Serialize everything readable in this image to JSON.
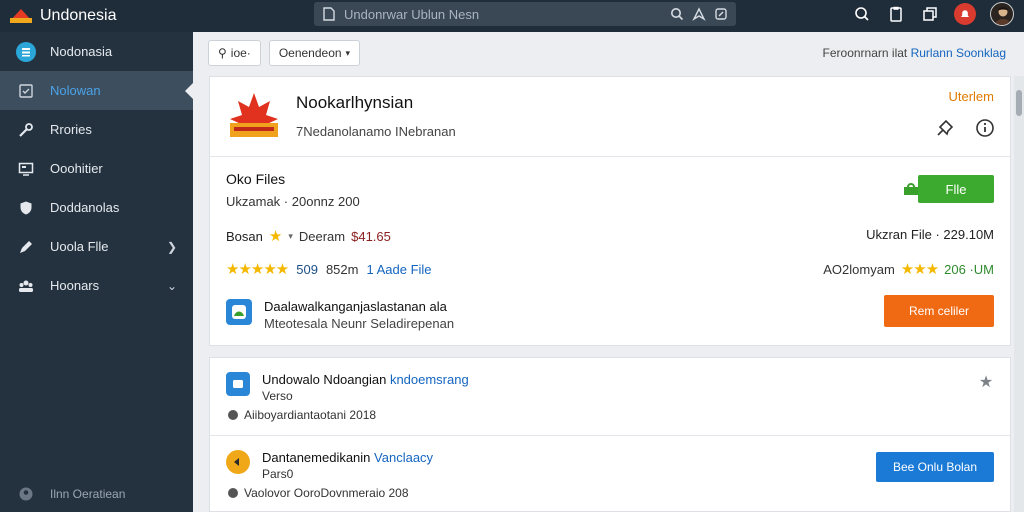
{
  "app": {
    "title": "Undonesia",
    "search_placeholder": "Undonrwar Ublun Nesn"
  },
  "sidebar": {
    "items": [
      {
        "label": "Nodonasia",
        "icon": "globe-icon"
      },
      {
        "label": "Nolowan",
        "icon": "document-icon"
      },
      {
        "label": "Rrories",
        "icon": "wrench-icon"
      },
      {
        "label": "Ooohitier",
        "icon": "monitor-icon"
      },
      {
        "label": "Doddanolas",
        "icon": "shield-icon"
      },
      {
        "label": "Uoola Flle",
        "icon": "pencil-icon"
      },
      {
        "label": "Hoonars",
        "icon": "people-icon"
      }
    ],
    "footer": "Ilnn Oeratiean"
  },
  "toolbar": {
    "filter_label": "ioe·",
    "category_label": "Oenendeon",
    "sort_prefix": "Feroonrnarn ilat",
    "sort_link": "Rurlann Soonklag"
  },
  "main_card": {
    "title": "Nookarlhynsian",
    "subtitle": "7Nedanolanamo INebranan",
    "status": "Uterlem",
    "files_title": "Oko Files",
    "files_meta_label": "Ukzamak",
    "files_meta_value": "20onnz 200",
    "region": "Bosan",
    "price_label": "Deeram",
    "price": "$41.65",
    "download_label": "Ukzran File",
    "download_size": "229.10M",
    "rating_count": "509",
    "rating_mid": "852m",
    "rating_link": "1 Aade File",
    "author_label": "AO2lomyam",
    "author_count": "206 ·UM",
    "files_button": "Flle",
    "feature_title": "Daalawalkanganjaslastanan ala",
    "feature_sub": "Mteotesala Neunr Seladirepenan",
    "remind_button": "Rem celiler"
  },
  "list": [
    {
      "title": "Undowalo Ndoangian",
      "link": "kndoemsrang",
      "version": "Verso",
      "meta": "Aiiboyardiantaotani 2018"
    },
    {
      "title": "Dantanemedikanin",
      "link": "Vanclaacy",
      "version": "Pars0",
      "meta": "Vaolovor OoroDovnmeraio 208",
      "button": "Bee Onlu Bolan"
    }
  ],
  "colors": {
    "topbar": "#1f2d3a",
    "sidebar": "#243240",
    "accent_green": "#3caa2e",
    "accent_orange": "#f06a14",
    "accent_blue": "#1a7ad6",
    "star": "#f5b800"
  }
}
